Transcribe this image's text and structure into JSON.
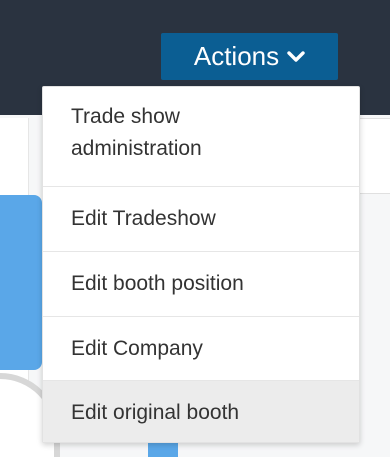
{
  "header": {
    "actions_label": "Actions",
    "actions_icon": "chevron-down-icon"
  },
  "menu": {
    "items": [
      {
        "label": "Trade show administration"
      },
      {
        "label": "Edit Tradeshow"
      },
      {
        "label": "Edit booth position"
      },
      {
        "label": "Edit Company"
      },
      {
        "label": "Edit original booth",
        "highlighted": true
      }
    ]
  },
  "colors": {
    "header_bg": "#2a3340",
    "button_bg": "#0b5e93",
    "highlight_bg": "#ececec",
    "accent_blue": "#5aa7e8"
  }
}
